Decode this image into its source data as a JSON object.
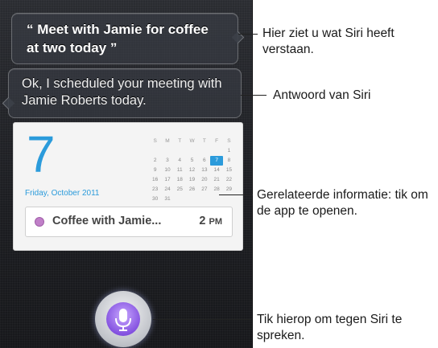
{
  "siri": {
    "user_quote": "“ Meet with Jamie for coffee at two today ”",
    "response": "Ok, I scheduled your meeting with Jamie Roberts today."
  },
  "calendar_card": {
    "day": "7",
    "date": "Friday, October 2011",
    "weekdays": [
      "S",
      "M",
      "T",
      "W",
      "T",
      "F",
      "S"
    ],
    "weeks": [
      [
        "",
        "",
        "",
        "",
        "",
        "",
        "1"
      ],
      [
        "2",
        "3",
        "4",
        "5",
        "6",
        "7",
        "8"
      ],
      [
        "9",
        "10",
        "11",
        "12",
        "13",
        "14",
        "15"
      ],
      [
        "16",
        "17",
        "18",
        "19",
        "20",
        "21",
        "22"
      ],
      [
        "23",
        "24",
        "25",
        "26",
        "27",
        "28",
        "29"
      ],
      [
        "30",
        "31",
        "",
        "",
        "",
        "",
        ""
      ]
    ],
    "today": "7",
    "event_title": "Coffee with Jamie...",
    "event_time": "2",
    "event_ampm": "PM",
    "event_color": "#c07fc8"
  },
  "annotations": {
    "understood": "Hier ziet u wat Siri heeft verstaan.",
    "answer": "Antwoord van Siri",
    "related": "Gerelateerde informatie: tik om de app te openen.",
    "tap": "Tik hierop om tegen Siri te spreken."
  },
  "icons": {
    "mic": "microphone-icon"
  }
}
